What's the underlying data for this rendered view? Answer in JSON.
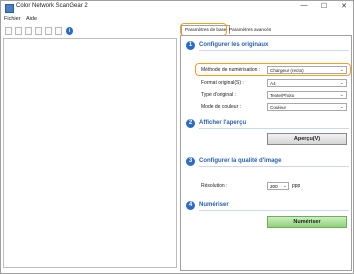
{
  "window": {
    "title": "Color Network ScanGear 2",
    "min_glyph": "—",
    "max_glyph": "☐",
    "close_glyph": "✕"
  },
  "menu": {
    "file": "Fichier",
    "help": "Aide"
  },
  "toolbar": {
    "icons": [
      "new-icon",
      "open-icon",
      "print-icon",
      "zoom-icon",
      "copy-icon",
      "window-icon",
      "info-icon"
    ],
    "info_glyph": "i"
  },
  "tabs": {
    "basic": "Paramètres de base",
    "advanced": "Paramètres avancés"
  },
  "section1": {
    "number": "1",
    "title": "Configurer les originaux",
    "fields": [
      {
        "label": "Méthode de numérisation :",
        "value": "Chargeur (recto)"
      },
      {
        "label": "Format original(S) :",
        "value": "A4"
      },
      {
        "label": "Type d'original :",
        "value": "Texte/Photo"
      },
      {
        "label": "Mode de couleur :",
        "value": "Couleur"
      }
    ]
  },
  "section2": {
    "number": "2",
    "title": "Afficher l'aperçu",
    "button": "Aperçu(V)"
  },
  "section3": {
    "number": "3",
    "title": "Configurer la qualité d'image",
    "resolution_label": "Résolution :",
    "resolution_value": "200",
    "resolution_unit": "ppp"
  },
  "section4": {
    "number": "4",
    "title": "Numériser",
    "button": "Numériser"
  },
  "highlight_color": "#f3a21b",
  "accent_color": "#2a6dc9"
}
